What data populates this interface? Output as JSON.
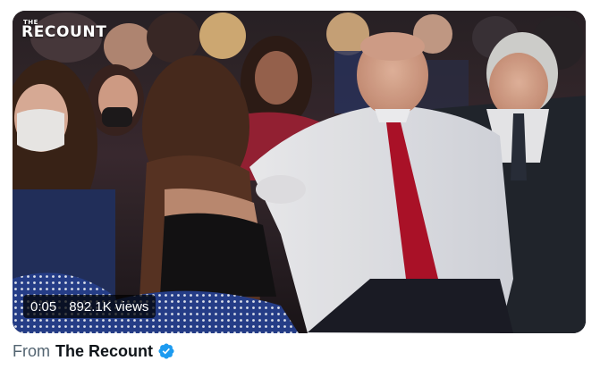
{
  "video": {
    "watermark_small": "THE",
    "watermark_big": "RECOUNT",
    "elapsed_time": "0:05",
    "views": "892.1K views"
  },
  "source": {
    "prefix": "From",
    "account_name": "The Recount"
  },
  "colors": {
    "verified_badge": "#1d9bf0",
    "secondary_text": "#536471",
    "primary_text": "#0f1419",
    "tie_red": "#b3122a"
  },
  "icons": {
    "verified": "verified-badge-icon"
  }
}
